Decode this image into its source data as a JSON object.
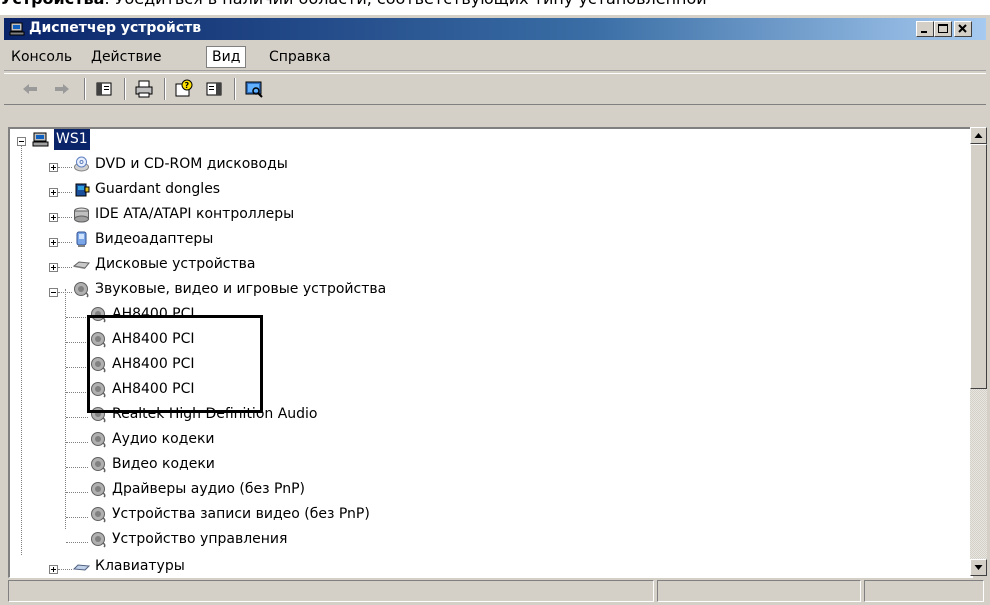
{
  "doc_text": {
    "bold": "Устройства",
    "rest": ". Убедиться в наличии области, соответствующих типу установленной"
  },
  "window": {
    "title": "Диспетчер устройств",
    "min_glyph": "_",
    "max_glyph": "□",
    "close_glyph": "×"
  },
  "menu": [
    "Консоль",
    "Действие",
    "Вид",
    "Справка"
  ],
  "toolbar": {
    "icons": [
      "back-arrow-icon",
      "forward-arrow-icon",
      "show-hide-console-tree-icon",
      "print-icon",
      "help-icon",
      "show-hide-action-pane-icon",
      "scan-hardware-icon"
    ]
  },
  "tree": {
    "root": "WS1",
    "items": [
      {
        "label": "DVD и CD-ROM дисководы",
        "icon": "dvd-drive-icon",
        "state": "collapsed"
      },
      {
        "label": "Guardant dongles",
        "icon": "dongle-icon",
        "state": "collapsed"
      },
      {
        "label": "IDE ATA/ATAPI контроллеры",
        "icon": "ide-controller-icon",
        "state": "collapsed"
      },
      {
        "label": "Видеоадаптеры",
        "icon": "display-adapter-icon",
        "state": "collapsed"
      },
      {
        "label": "Дисковые устройства",
        "icon": "disk-drive-icon",
        "state": "collapsed"
      },
      {
        "label": "Звуковые, видео и игровые устройства",
        "icon": "sound-device-icon",
        "state": "expanded"
      }
    ],
    "children": [
      "AH8400 PCI",
      "AH8400 PCI",
      "AH8400 PCI",
      "AH8400 PCI",
      "Realtek High Definition Audio",
      "Аудио кодеки",
      "Видео кодеки",
      "Драйверы аудио (без PnP)",
      "Устройства записи видео (без PnP)",
      "Устройство управления"
    ],
    "last": {
      "label": "Клавиатуры",
      "icon": "keyboard-icon",
      "state": "collapsed"
    }
  },
  "colors": {
    "title_start": "#0a246a",
    "title_end": "#a6caf0",
    "face": "#d4d0c8",
    "selection": "#0a246a",
    "highlight_box": "#000000"
  }
}
